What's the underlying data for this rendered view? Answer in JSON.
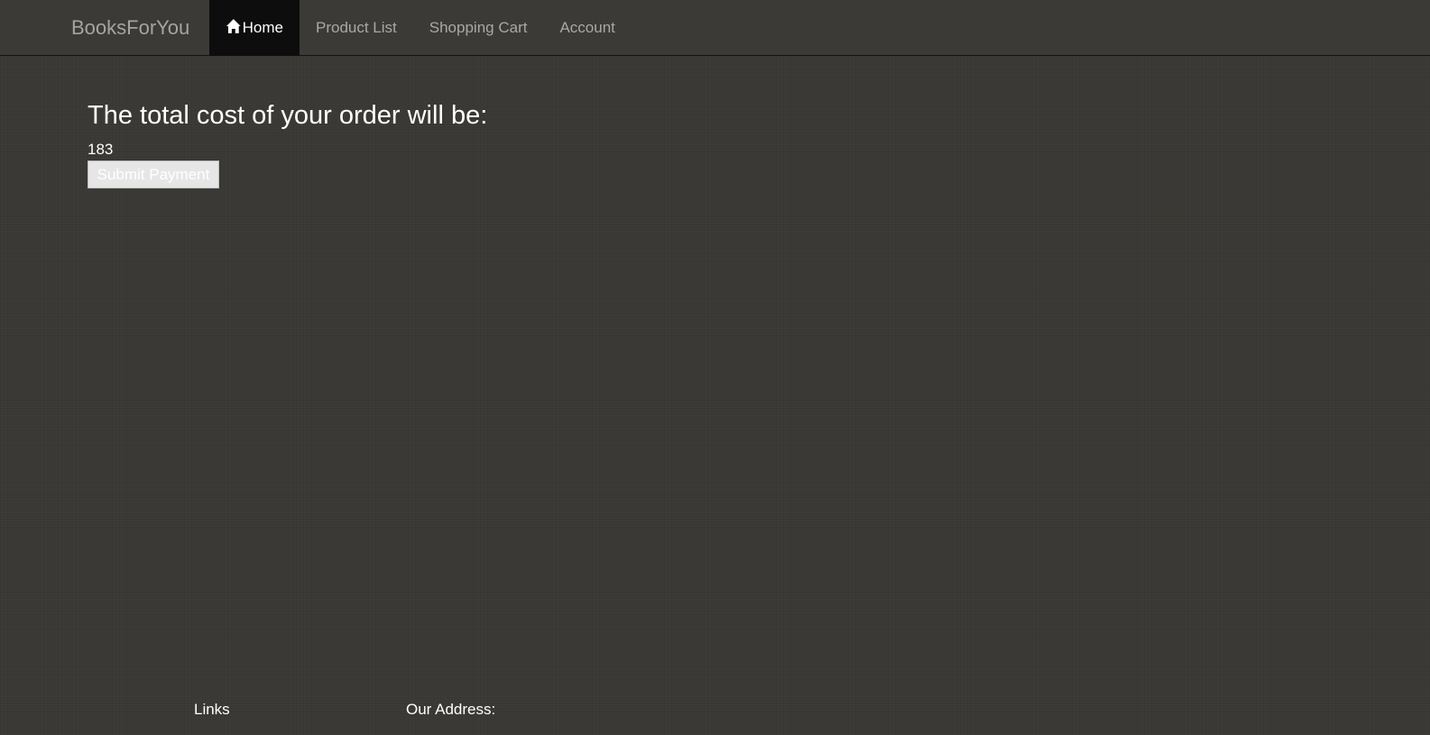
{
  "navbar": {
    "brand": "BooksForYou",
    "items": [
      {
        "label": "Home",
        "icon": "home-icon",
        "active": true
      },
      {
        "label": "Product List",
        "active": false
      },
      {
        "label": "Shopping Cart",
        "active": false
      },
      {
        "label": "Account",
        "active": false
      }
    ]
  },
  "main": {
    "heading": "The total cost of your order will be:",
    "total": "183",
    "submit_label": "Submit Payment"
  },
  "footer": {
    "links_heading": "Links",
    "address_heading": "Our Address:"
  },
  "colors": {
    "background": "#3a3935",
    "navbar_active": "#0d0d0d",
    "nav_text": "#a8a8a5",
    "button_bg": "#e6e6e6"
  }
}
